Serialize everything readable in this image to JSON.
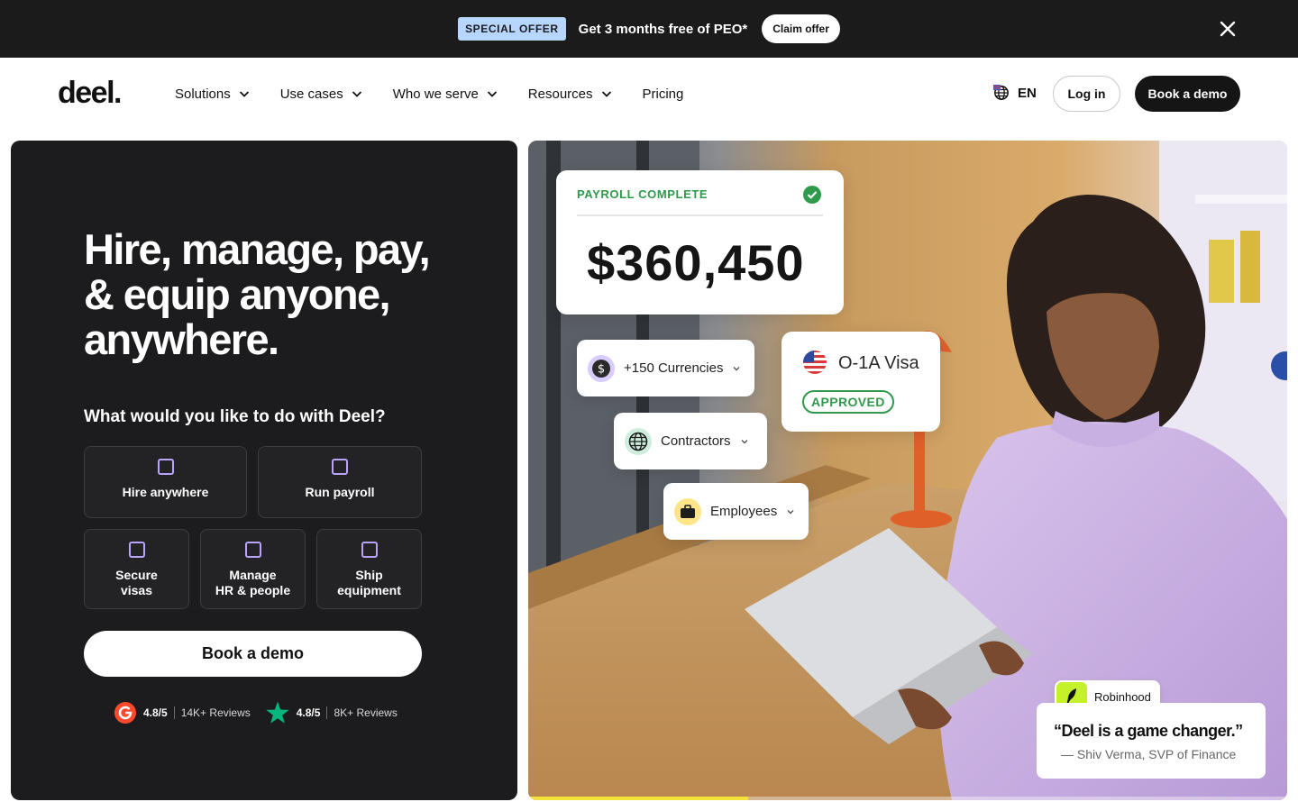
{
  "promo": {
    "badge": "SPECIAL OFFER",
    "text": "Get 3 months free of PEO*",
    "cta": "Claim offer",
    "badge_color": "#b7d6ff",
    "bg_color": "#1b1b1b"
  },
  "nav": {
    "logo": "deel.",
    "links": [
      {
        "label": "Solutions",
        "has_dropdown": true
      },
      {
        "label": "Use cases",
        "has_dropdown": true
      },
      {
        "label": "Who we serve",
        "has_dropdown": true
      },
      {
        "label": "Resources",
        "has_dropdown": true
      },
      {
        "label": "Pricing",
        "has_dropdown": false
      }
    ],
    "language": "EN",
    "login": "Log in",
    "book_demo": "Book a demo"
  },
  "hero": {
    "title": "Hire, manage, pay, & equip anyone, anywhere.",
    "question": "What would you like to do with Deel?",
    "options": [
      {
        "label": "Hire anywhere"
      },
      {
        "label": "Run payroll"
      },
      {
        "label": "Secure\nvisas"
      },
      {
        "label": "Manage\nHR & people"
      },
      {
        "label": "Ship\nequipment"
      }
    ],
    "cta": "Book a demo",
    "ratings": [
      {
        "source_icon": "g2-icon",
        "score": "4.8/5",
        "reviews": "14K+ Reviews"
      },
      {
        "source_icon": "trustpilot-star-icon",
        "score": "4.8/5",
        "reviews": "8K+ Reviews"
      }
    ],
    "accent_color": "#b9a3ff",
    "panel_color": "#1c1b1d"
  },
  "visual": {
    "payroll_label": "PAYROLL COMPLETE",
    "payroll_amount": "$360,450",
    "chips": [
      {
        "label": "+150 Currencies",
        "icon": "dollar-icon"
      },
      {
        "label": "Contractors",
        "icon": "globe-icon"
      },
      {
        "label": "Employees",
        "icon": "briefcase-icon"
      }
    ],
    "visa_title": "O-1A Visa",
    "visa_status": "APPROVED",
    "status_color": "#2f9a4b",
    "carousel_progress": 0.29,
    "testimonial": {
      "brand": "Robinhood",
      "quote": "“Deel is a game changer.”",
      "author": "— Shiv Verma, SVP of Finance"
    }
  }
}
